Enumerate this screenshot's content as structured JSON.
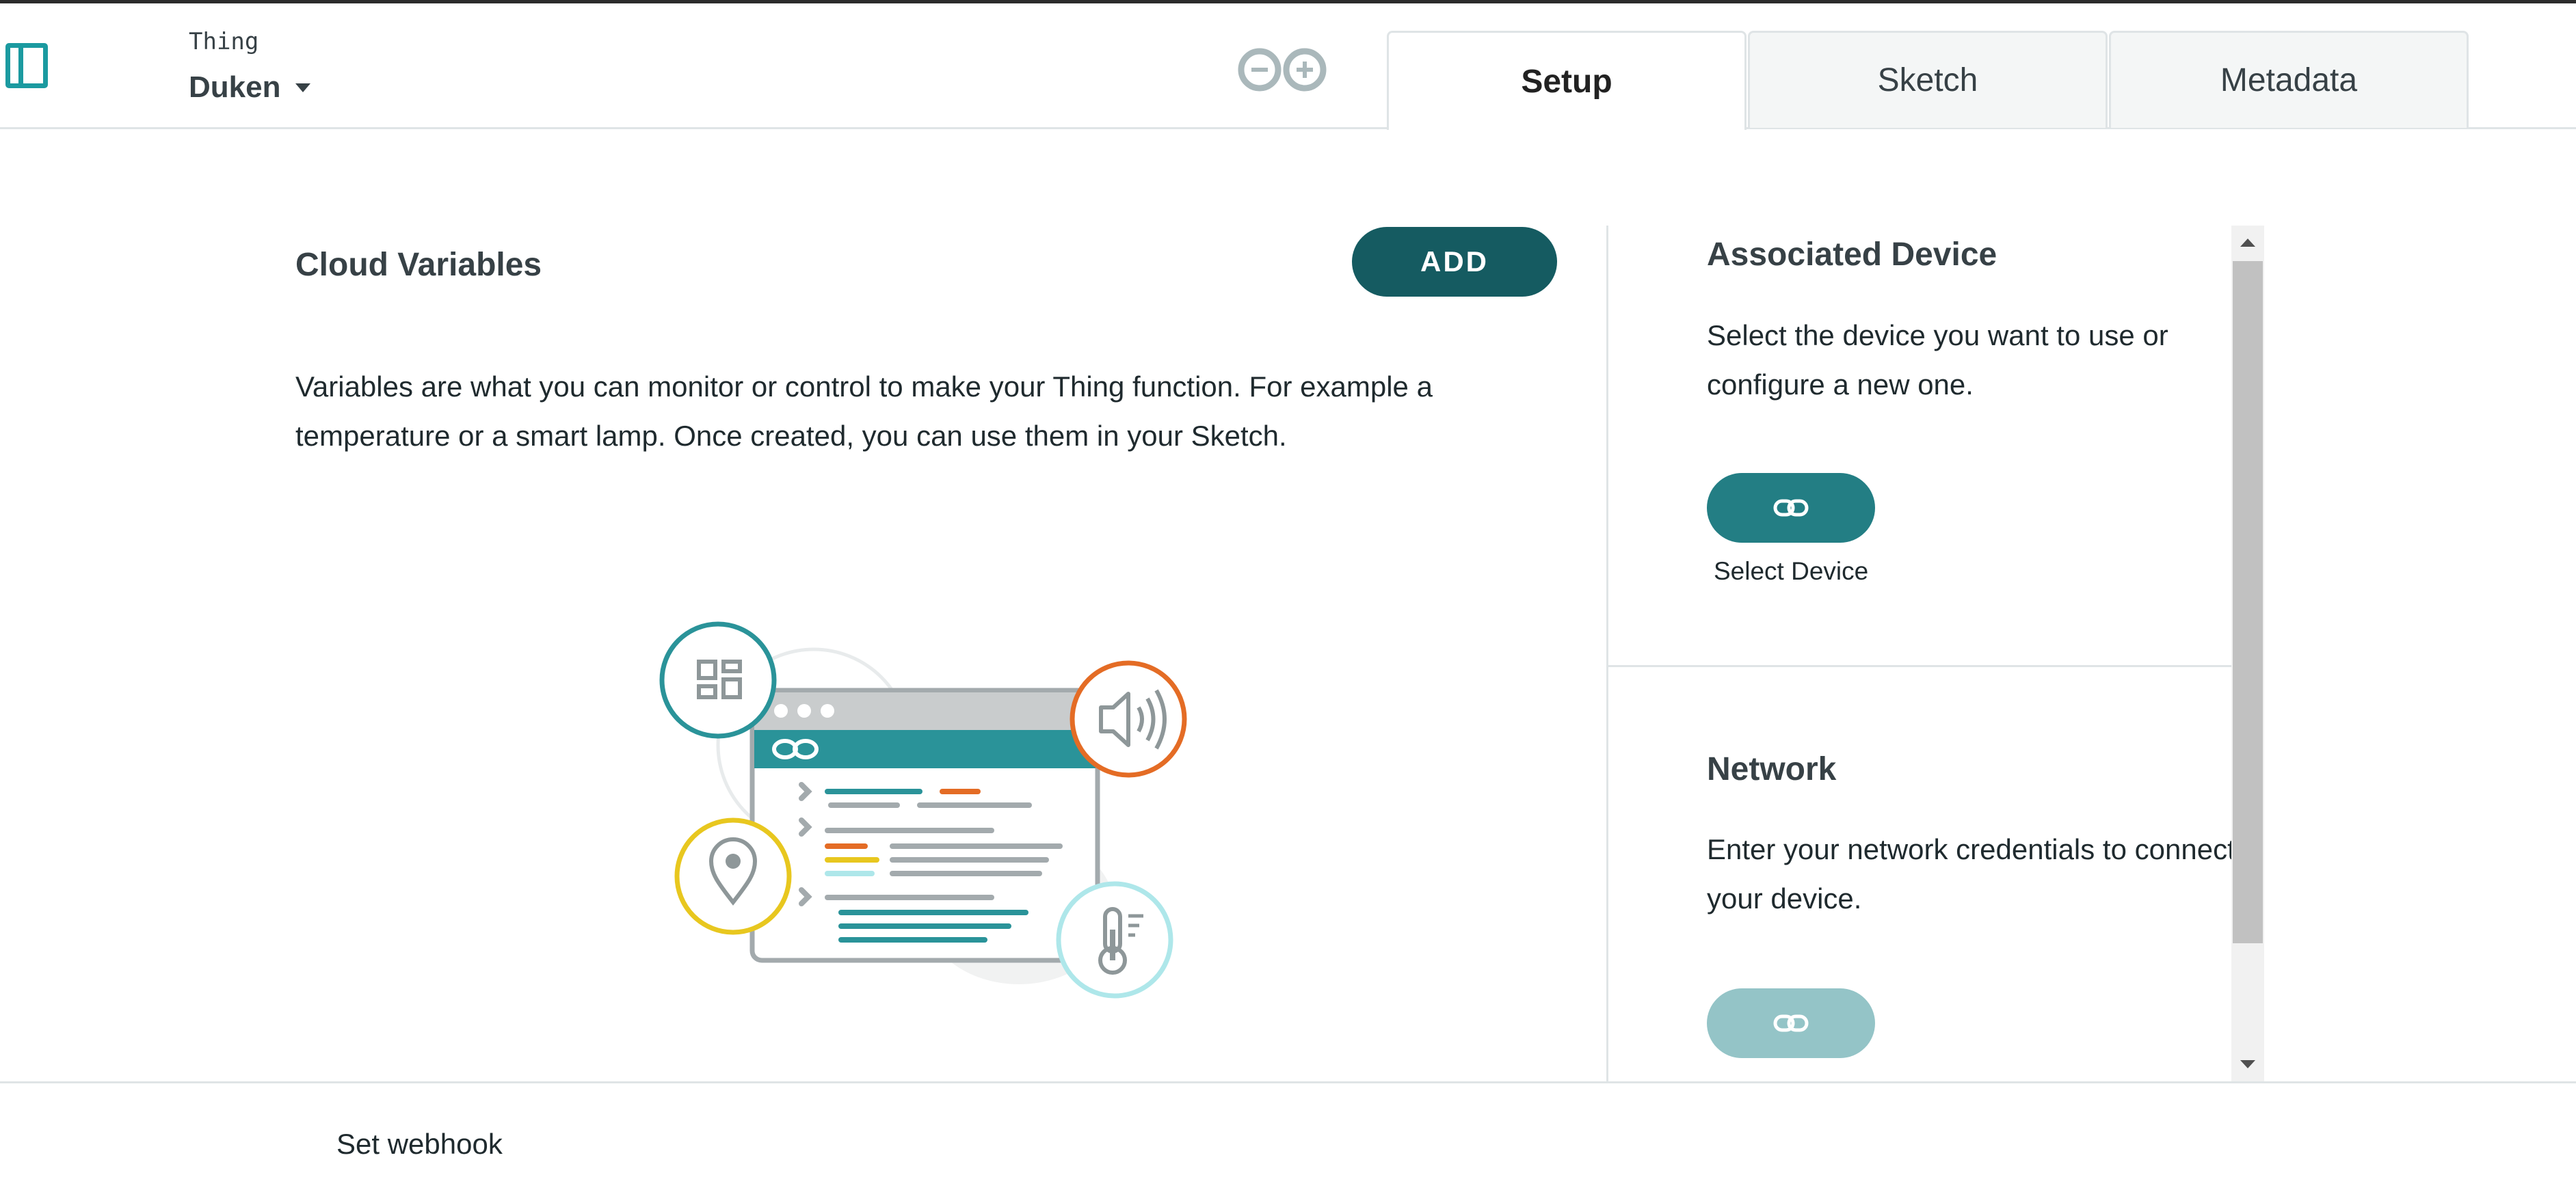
{
  "header": {
    "thing_label": "Thing",
    "thing_name": "Duken",
    "tabs": [
      {
        "label": "Setup",
        "active": true
      },
      {
        "label": "Sketch",
        "active": false
      },
      {
        "label": "Metadata",
        "active": false
      }
    ]
  },
  "cloud_variables": {
    "title": "Cloud Variables",
    "add_label": "ADD",
    "description": "Variables are what you can monitor or control to make your Thing function. For example a temperature or a smart lamp. Once created, you can use them in your Sketch."
  },
  "associated_device": {
    "title": "Associated Device",
    "description": "Select the device you want to use or configure a new one.",
    "button_label": "Select Device"
  },
  "network": {
    "title": "Network",
    "description": "Enter your network credentials to connect your device."
  },
  "footer": {
    "webhook_label": "Set webhook"
  },
  "icons": [
    "sidebar-toggle-icon",
    "dropdown-caret-icon",
    "arduino-logo-icon",
    "link-icon",
    "dashboard-icon",
    "speaker-icon",
    "location-pin-icon",
    "thermometer-icon",
    "infinity-icon"
  ],
  "colors": {
    "accent": "#1b9aa0",
    "add_button": "#155b61",
    "select_button": "#237e84",
    "network_button_disabled": "#94c4c7",
    "text": "#374146",
    "orange": "#e46c25",
    "yellow": "#e8c71f",
    "light_cyan": "#aee7ea"
  }
}
